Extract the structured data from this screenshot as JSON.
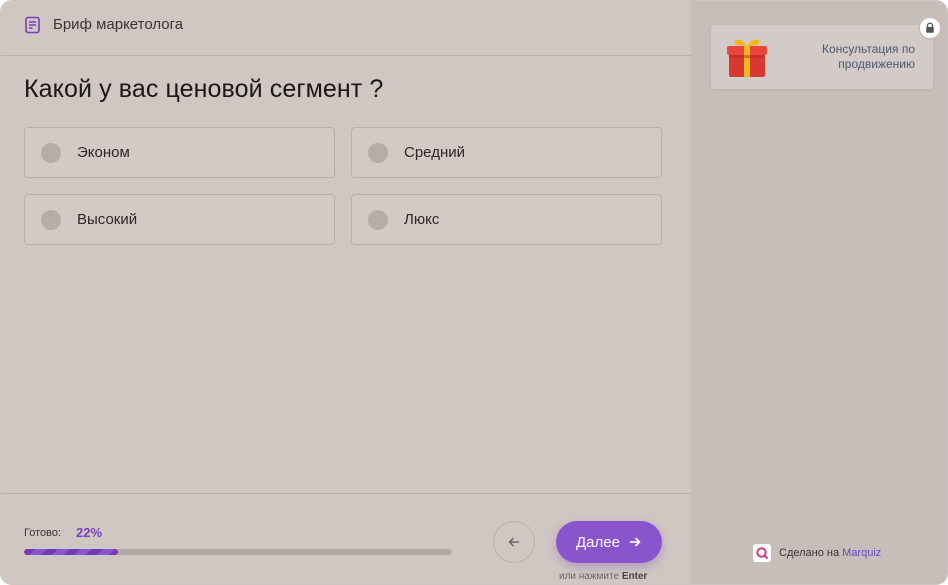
{
  "header": {
    "title": "Бриф маркетолога",
    "icon": "brief-list-icon"
  },
  "question": "Какой у вас ценовой сегмент ?",
  "options": [
    {
      "label": "Эконом"
    },
    {
      "label": "Средний"
    },
    {
      "label": "Высокий"
    },
    {
      "label": "Люкс"
    }
  ],
  "footer": {
    "progress_label": "Готово:",
    "progress_value": "22%",
    "progress_fraction": 0.22,
    "next_label": "Далее",
    "hint_prefix": "или нажмите",
    "hint_key": "Enter"
  },
  "side": {
    "gift_text": "Консультация по продвижению",
    "made_by_prefix": "Сделано на",
    "made_by_brand": "Marquiz"
  },
  "colors": {
    "accent": "#8a55cc",
    "progress": "#7a3fc0",
    "brand": "#6d46c0"
  }
}
